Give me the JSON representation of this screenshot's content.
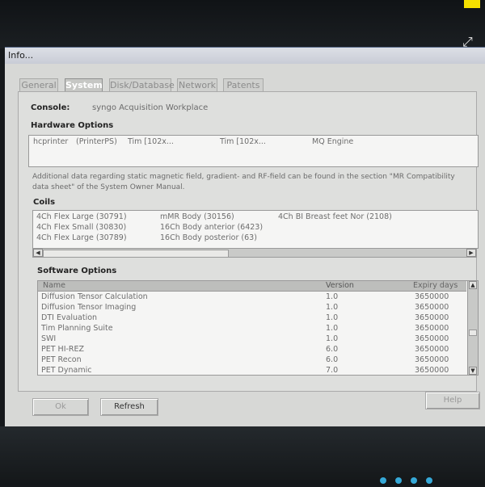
{
  "window": {
    "title": "Info..."
  },
  "tabs": [
    {
      "label": "General",
      "active": false
    },
    {
      "label": "System",
      "active": true
    },
    {
      "label": "Disk/Database",
      "active": false
    },
    {
      "label": "Network",
      "active": false
    },
    {
      "label": "Patents",
      "active": false
    }
  ],
  "console": {
    "label": "Console:",
    "value": "syngo Acquisition Workplace"
  },
  "hardware": {
    "heading": "Hardware Options",
    "items": [
      "hcprinter",
      "(PrinterPS)",
      "Tim [102x...",
      "Tim [102x...",
      "MQ Engine"
    ]
  },
  "note": {
    "line1": "Additional data regarding static magnetic field, gradient- and RF-field can be found in the section \"MR Compatibility",
    "line2": "data sheet\" of the System Owner Manual."
  },
  "coils": {
    "heading": "Coils",
    "items": [
      "4Ch Flex Large (30791)",
      "4Ch Flex Small (30830)",
      "4Ch Flex Large (30789)",
      "mMR Body (30156)",
      "16Ch Body anterior (6423)",
      "16Ch Body posterior (63)",
      "4Ch BI Breast feet Nor (2108)"
    ]
  },
  "software": {
    "heading": "Software Options",
    "columns": [
      "Name",
      "Version",
      "Expiry days"
    ],
    "rows": [
      [
        "Diffusion Tensor Calculation",
        "1.0",
        "3650000"
      ],
      [
        "Diffusion Tensor Imaging",
        "1.0",
        "3650000"
      ],
      [
        "DTI Evaluation",
        "1.0",
        "3650000"
      ],
      [
        "Tim Planning Suite",
        "1.0",
        "3650000"
      ],
      [
        "SWI",
        "1.0",
        "3650000"
      ],
      [
        "PET HI-REZ",
        "6.0",
        "3650000"
      ],
      [
        "PET Recon",
        "6.0",
        "3650000"
      ],
      [
        "PET Dynamic",
        "7.0",
        "3650000"
      ]
    ]
  },
  "buttons": {
    "ok": "Ok",
    "refresh": "Refresh",
    "help": "Help"
  }
}
